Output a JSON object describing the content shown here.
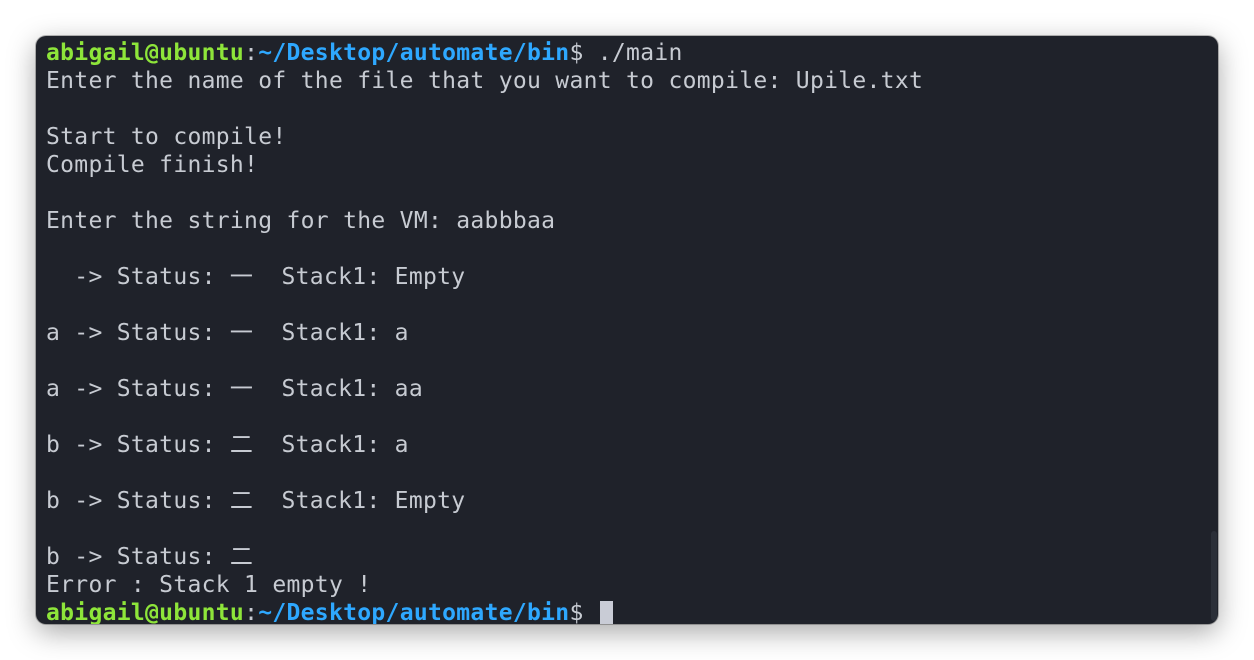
{
  "prompt": {
    "user_host": "abigail@ubuntu",
    "separator": ":",
    "path": "~/Desktop/automate/bin",
    "symbol": "$ "
  },
  "first_command": "./main",
  "output": [
    "Enter the name of the file that you want to compile: Upile.txt",
    "",
    "Start to compile!",
    "Compile finish!",
    "",
    "Enter the string for the VM: aabbbaa",
    "",
    "  -> Status: 一  Stack1: Empty",
    "",
    "a -> Status: 一  Stack1: a",
    "",
    "a -> Status: 一  Stack1: aa",
    "",
    "b -> Status: 二  Stack1: a",
    "",
    "b -> Status: 二  Stack1: Empty",
    "",
    "b -> Status: 二",
    "Error : Stack 1 empty !"
  ]
}
